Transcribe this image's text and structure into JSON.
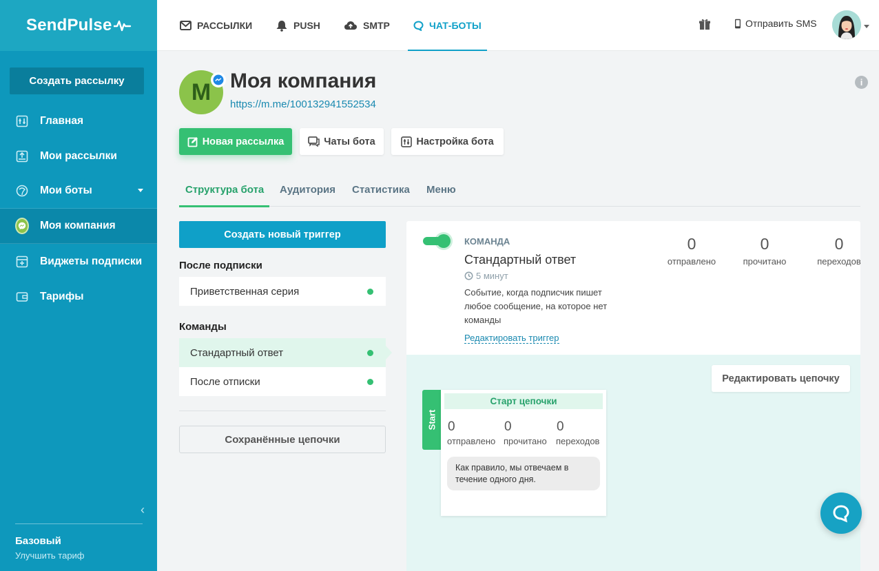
{
  "brand": {
    "name": "SendPulse"
  },
  "sidebar": {
    "create_label": "Создать рассылку",
    "items": [
      {
        "label": "Главная",
        "icon": "dashboard-icon"
      },
      {
        "label": "Мои рассылки",
        "icon": "mailings-icon"
      },
      {
        "label": "Мои боты",
        "icon": "bots-icon"
      },
      {
        "label": "Моя компания",
        "icon": "company-avatar"
      },
      {
        "label": "Виджеты подписки",
        "icon": "widget-icon"
      },
      {
        "label": "Тарифы",
        "icon": "wallet-icon"
      }
    ],
    "plan": "Базовый",
    "upgrade": "Улучшить тариф"
  },
  "topnav": {
    "tabs": [
      {
        "label": "РАССЫЛКИ",
        "icon": "mail-icon"
      },
      {
        "label": "PUSH",
        "icon": "bell-icon"
      },
      {
        "label": "SMTP",
        "icon": "cloud-icon"
      },
      {
        "label": "ЧАТ-БОТЫ",
        "icon": "chat-icon"
      }
    ],
    "sms_label": "Отправить SMS"
  },
  "bot": {
    "initial": "М",
    "name": "Моя компания",
    "link": "https://m.me/100132941552534"
  },
  "actions": {
    "new_mailing": "Новая рассылка",
    "bot_chats": "Чаты бота",
    "bot_settings": "Настройка бота"
  },
  "tabs": [
    "Структура бота",
    "Аудитория",
    "Статистика",
    "Меню"
  ],
  "triggers": {
    "create_label": "Создать новый триггер",
    "after_subscribe_title": "После подписки",
    "after_subscribe": [
      "Приветственная серия"
    ],
    "commands_title": "Команды",
    "commands": [
      "Стандартный ответ",
      "После отписки"
    ],
    "saved_label": "Сохранённые цепочки"
  },
  "command": {
    "type_label": "КОМАНДА",
    "title": "Стандартный ответ",
    "time": "5 минут",
    "description": "Событие, когда подписчик пишет любое сообщение, на которое нет команды",
    "edit_label": "Редактировать триггер",
    "stats": [
      {
        "value": "0",
        "label": "отправлено"
      },
      {
        "value": "0",
        "label": "прочитано"
      },
      {
        "value": "0",
        "label": "переходов"
      }
    ]
  },
  "chain": {
    "edit_label": "Редактировать цепочку",
    "start_tab": "Start",
    "head": "Старт цепочки",
    "stats": [
      {
        "value": "0",
        "label": "отправлено"
      },
      {
        "value": "0",
        "label": "прочитано"
      },
      {
        "value": "0",
        "label": "переходов"
      }
    ],
    "message": "Как правило, мы отвечаем в течение одного дня."
  },
  "colors": {
    "sidebar": "#0e98bc",
    "accent": "#0fa0c8",
    "green": "#35c073"
  }
}
